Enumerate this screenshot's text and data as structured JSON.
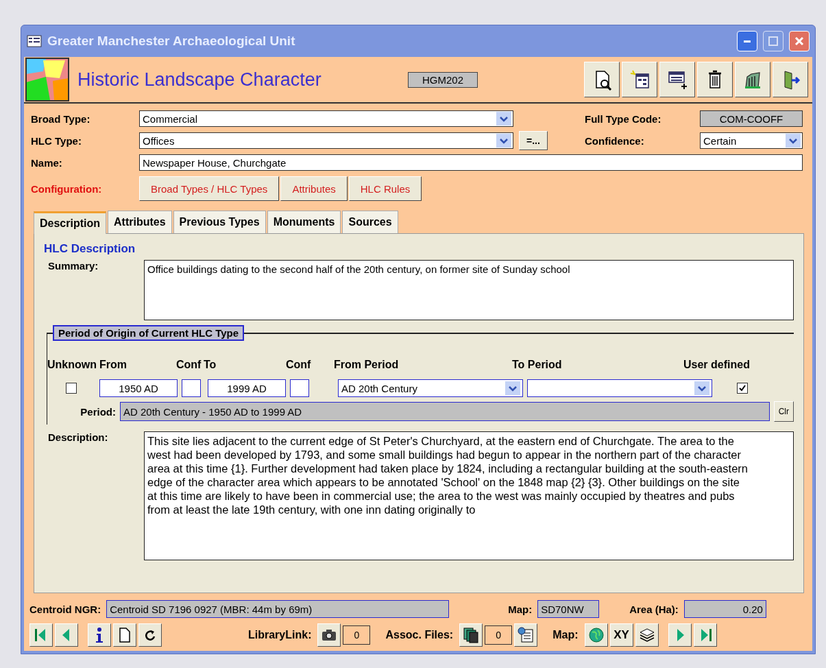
{
  "window": {
    "title": "Greater Manchester Archaeological Unit"
  },
  "header": {
    "title": "Historic Landscape Character",
    "record_code": "HGM202"
  },
  "broad_type": {
    "label": "Broad Type:",
    "value": "Commercial"
  },
  "hlc_type": {
    "label": "HLC Type:",
    "value": "Offices",
    "button": "=..."
  },
  "full_type_code": {
    "label": "Full Type Code:",
    "value": "COM-COOFF"
  },
  "confidence": {
    "label": "Confidence:",
    "value": "Certain"
  },
  "name": {
    "label": "Name:",
    "value": "Newspaper House, Churchgate"
  },
  "configuration": {
    "label": "Configuration:",
    "buttons": [
      "Broad Types / HLC Types",
      "Attributes",
      "HLC Rules"
    ]
  },
  "tabs": [
    {
      "label": "Description",
      "selected": true
    },
    {
      "label": "Attributes",
      "selected": false
    },
    {
      "label": "Previous Types",
      "selected": false
    },
    {
      "label": "Monuments",
      "selected": false
    },
    {
      "label": "Sources",
      "selected": false
    }
  ],
  "panel": {
    "heading": "HLC Description",
    "summary": {
      "label": "Summary:",
      "value": "Office buildings dating to the second half of the 20th century, on former site of Sunday school"
    },
    "period_origin": {
      "legend": "Period of Origin of Current HLC Type",
      "columns": [
        "Unknown",
        "From",
        "Conf",
        "To",
        "Conf",
        "From Period",
        "To Period",
        "User defined"
      ],
      "unknown": {
        "checked": false
      },
      "from": "1950 AD",
      "to": "1999 AD",
      "from_period": "AD 20th Century",
      "user_defined": {
        "checked": true
      },
      "period": {
        "label": "Period:",
        "value": "AD 20th Century - 1950 AD to 1999 AD"
      },
      "clear_button": "Clr"
    },
    "description": {
      "label": "Description:",
      "value": "This site lies adjacent to the current edge of St Peter's Churchyard, at the eastern end of Churchgate.  The area to the west had been developed by 1793, and some small buildings had begun to appear in the northern part of the character area at this time {1}.  Further development had taken place by 1824, including a rectangular building at the south-eastern edge of the character area which appears to be annotated 'School' on the 1848 map {2} {3}.  Other buildings on the site at this time are likely to have been in commercial use; the area to the west was mainly occupied by theatres and pubs from at least the late 19th century, with one inn dating originally to"
    }
  },
  "footer": {
    "centroid": {
      "label": "Centroid NGR:",
      "value": "Centroid SD 7196 0927  (MBR: 44m by 69m)"
    },
    "map": {
      "label": "Map:",
      "value": "SD70NW"
    },
    "area": {
      "label": "Area (Ha):",
      "value": "0.20"
    }
  },
  "navigation": {
    "library_label": "LibraryLink:",
    "library_count": "0",
    "assoc_label": "Assoc. Files:",
    "assoc_count": "0",
    "map_label": "Map:",
    "xy_button": "XY"
  }
}
